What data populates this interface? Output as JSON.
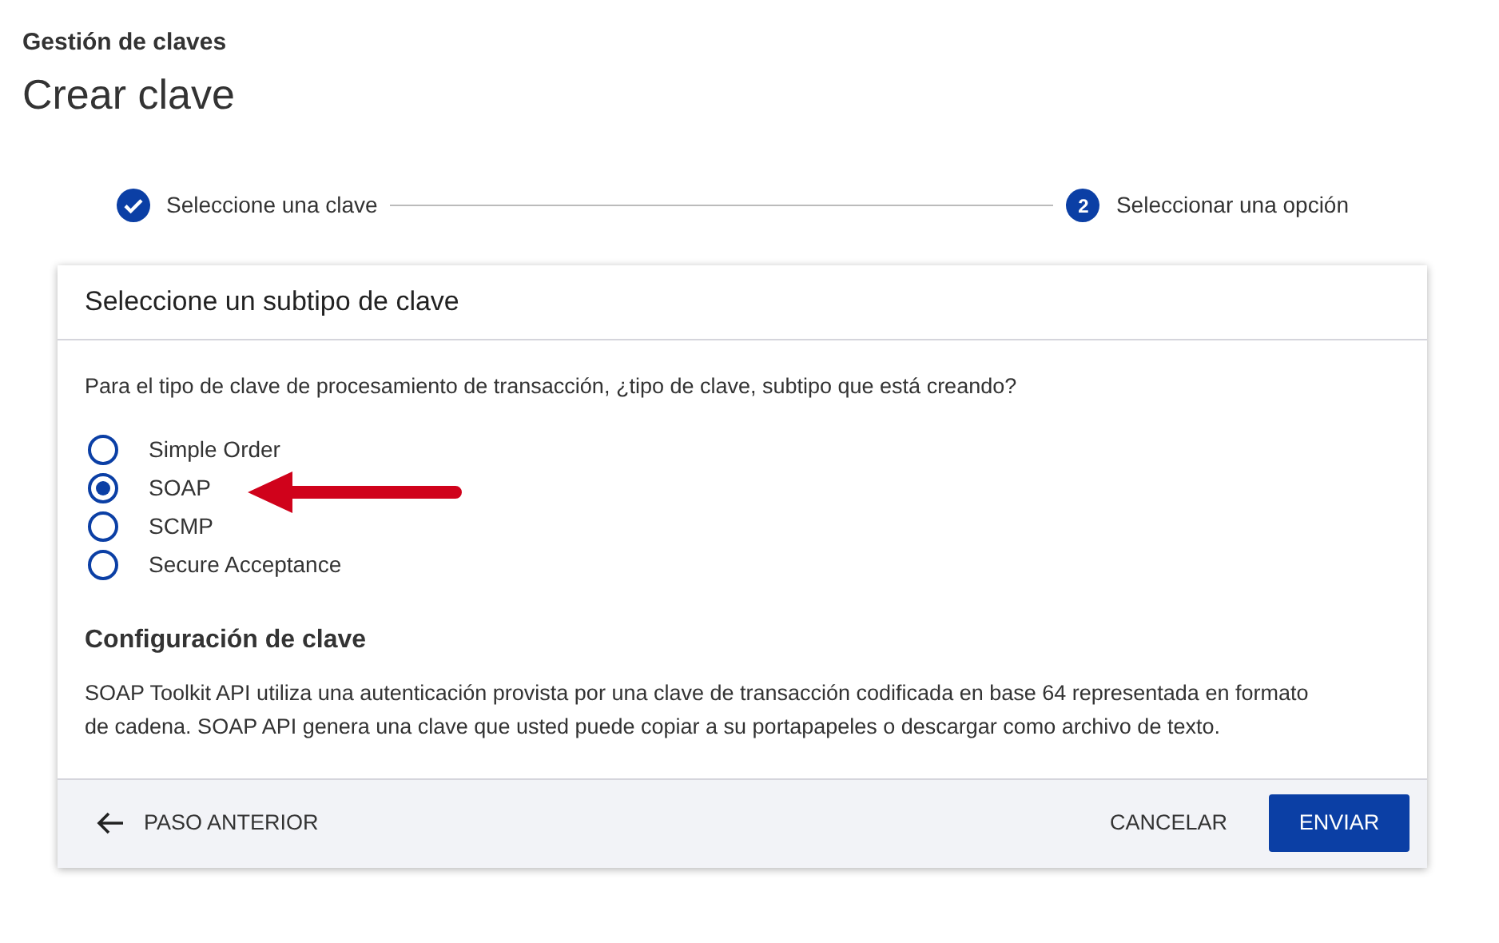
{
  "breadcrumb": "Gestión de claves",
  "page_title": "Crear clave",
  "steps": [
    {
      "label": "Seleccione una clave",
      "completed": true
    },
    {
      "label": "Seleccionar una opción",
      "completed": false,
      "number": "2"
    }
  ],
  "card": {
    "title": "Seleccione un subtipo de clave",
    "question": "Para el tipo de clave de procesamiento de transacción, ¿tipo de clave, subtipo que está creando?",
    "options": [
      {
        "label": "Simple Order",
        "selected": false
      },
      {
        "label": "SOAP",
        "selected": true
      },
      {
        "label": "SCMP",
        "selected": false
      },
      {
        "label": "Secure Acceptance",
        "selected": false
      }
    ],
    "section_title": "Configuración de clave",
    "description": "SOAP Toolkit API utiliza una autenticación provista por una clave de transacción codificada en base 64 representada en formato de cadena. SOAP API genera una clave que usted puede copiar a su portapapeles o descargar como archivo de texto."
  },
  "footer": {
    "back": "PASO ANTERIOR",
    "cancel": "CANCELAR",
    "submit": "ENVIAR"
  }
}
